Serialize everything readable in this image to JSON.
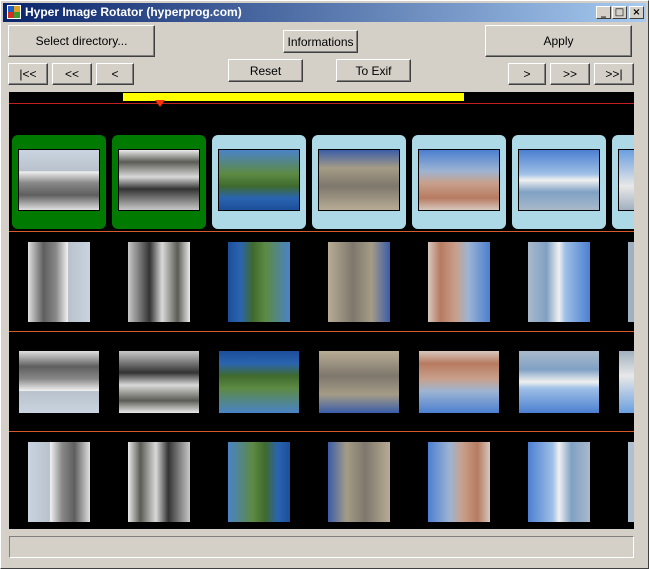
{
  "window": {
    "title": "Hyper Image Rotator (hyperprog.com)"
  },
  "titlebar_buttons": {
    "minimize": "_",
    "maximize": "□",
    "close": "×"
  },
  "toolbar": {
    "select_directory": "Select directory...",
    "informations": "Informations",
    "apply": "Apply",
    "reset": "Reset",
    "to_exif": "To Exif"
  },
  "navigation": {
    "first": "|<<",
    "prev_page": "<<",
    "prev": "<",
    "next": ">",
    "next_page": ">>",
    "last": ">>|"
  },
  "colors": {
    "selected_frame": "#007a00",
    "unselected_frame": "#add8e6",
    "slider": "#ffff00",
    "marker": "#ff3300",
    "separator": "#d65a2a"
  },
  "thumbnails": [
    {
      "image": "old-town-houses",
      "selected": true
    },
    {
      "image": "snowy-forest",
      "selected": true
    },
    {
      "image": "coastal-cliffs",
      "selected": false
    },
    {
      "image": "stone-wall-path",
      "selected": false
    },
    {
      "image": "waterfront-town",
      "selected": false
    },
    {
      "image": "lake-shore-building",
      "selected": false
    },
    {
      "image": "beach-partial",
      "selected": false
    }
  ],
  "status_bar": {
    "text": ""
  }
}
